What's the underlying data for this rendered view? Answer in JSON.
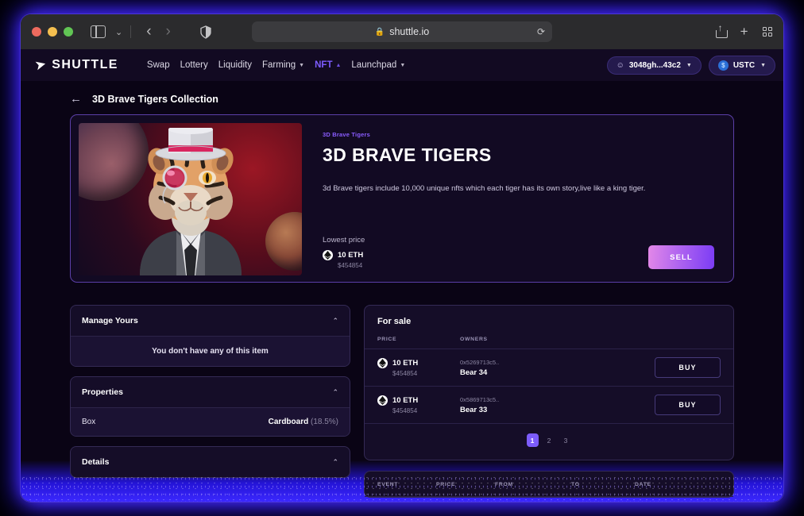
{
  "browser": {
    "url": "shuttle.io",
    "lock_icon": "lock-icon",
    "reload_icon": "reload-icon",
    "back_icon": "back-arrow-icon",
    "forward_icon": "forward-arrow-icon",
    "sidebar_icon": "sidebar-toggle-icon",
    "tab_chevron_icon": "chevron-down-icon",
    "shield_icon": "shield-icon",
    "share_icon": "share-icon",
    "new_tab_icon": "plus-icon",
    "tab_overview_icon": "grid-icon",
    "traffic_lights": [
      "close-red",
      "minimize-yellow",
      "zoom-green"
    ]
  },
  "nav": {
    "logo_text": "SHUTTLE",
    "logo_icon": "rocket-icon",
    "links": [
      {
        "label": "Swap",
        "caret": "",
        "active": false
      },
      {
        "label": "Lottery",
        "caret": "",
        "active": false
      },
      {
        "label": "Liquidity",
        "caret": "",
        "active": false
      },
      {
        "label": "Farming",
        "caret": "▼",
        "active": false
      },
      {
        "label": "NFT",
        "caret": "▲",
        "active": true
      },
      {
        "label": "Launchpad",
        "caret": "▼",
        "active": false
      }
    ],
    "wallet": {
      "label": "3048gh...43c2",
      "icon": "user-icon",
      "caret": "▼"
    },
    "token": {
      "label": "USTC",
      "icon": "ustc-coin-icon",
      "symbol": "$",
      "caret": "▼"
    }
  },
  "breadcrumb": {
    "back_icon": "back-arrow-icon",
    "title": "3D Brave Tigers Collection"
  },
  "hero": {
    "collection": "3D Brave Tigers",
    "title": "3D BRAVE TIGERS",
    "description": "3d Brave tigers include 10,000 unique nfts which each tiger has its own story,live like a king tiger.",
    "lowest_price_label": "Lowest price",
    "price_eth": "10 ETH",
    "price_usd": "$454854",
    "eth_icon": "ethereum-icon",
    "sell_label": "SELL",
    "image_alt": "3D tiger wearing a top hat, monocle and grey suit on a cosmic red background"
  },
  "left_panel": {
    "cards": [
      {
        "title": "Manage Yours",
        "chevron": "⌃",
        "empty_message": "You don't have any of this item"
      },
      {
        "title": "Properties",
        "chevron": "⌃",
        "rows": [
          {
            "key": "Box",
            "value": "Cardboard",
            "rarity": "(18.5%)"
          }
        ]
      },
      {
        "title": "Details",
        "chevron": "⌃"
      }
    ]
  },
  "for_sale": {
    "title": "For sale",
    "columns": [
      "PRICE",
      "OWNERS"
    ],
    "rows": [
      {
        "price_eth": "10 ETH",
        "price_usd": "$454854",
        "owner_address": "0x5269713c5..",
        "owner_name": "Bear 34",
        "action": "BUY"
      },
      {
        "price_eth": "10 ETH",
        "price_usd": "$454854",
        "owner_address": "0x5869713c5..",
        "owner_name": "Bear 33",
        "action": "BUY"
      }
    ],
    "pagination": {
      "pages": [
        "1",
        "2",
        "3"
      ],
      "current": "1"
    }
  },
  "events": {
    "columns": [
      "EVENT",
      "PRICE",
      "FROM",
      "TO",
      "DATE"
    ]
  },
  "colors": {
    "accent_purple": "#7d5cff",
    "glow_blue": "#3b28ff",
    "card_bg": "#150d28",
    "page_bg": "#0a0415",
    "sell_gradient_from": "#e388e8",
    "sell_gradient_to": "#7b3cf5"
  }
}
